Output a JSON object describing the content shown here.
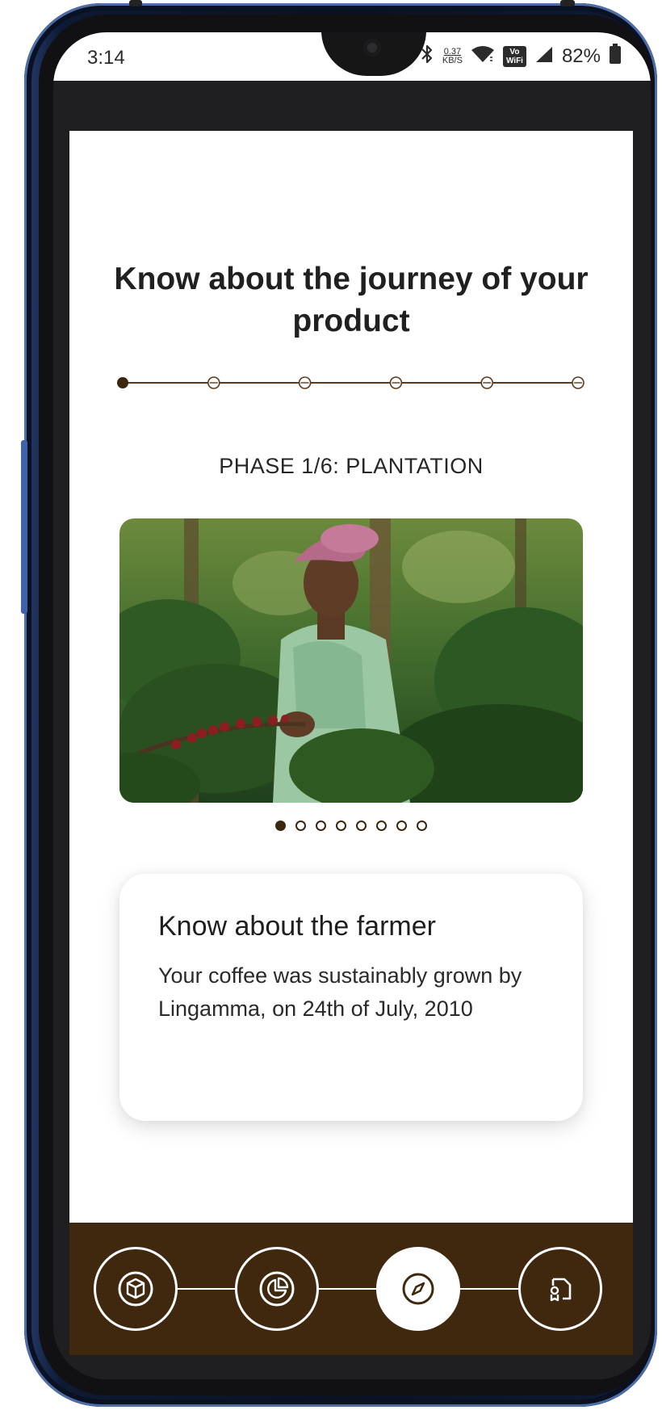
{
  "status_bar": {
    "time": "3:14",
    "network_speed_value": "0.37",
    "network_speed_unit": "KB/S",
    "volte_label_top": "Vo",
    "volte_label_bottom": "WiFi",
    "battery_percent": "82%",
    "icons": [
      "bluetooth-icon",
      "wifi-icon",
      "vowifi-icon",
      "signal-icon",
      "battery-icon"
    ]
  },
  "page": {
    "title": "Know about the journey of your product",
    "phase_label": "PHASE 1/6: PLANTATION",
    "timeline": {
      "total_steps": 6,
      "current_step": 1,
      "line_color": "#5a3a1a",
      "active_color": "#3b2610"
    },
    "carousel": {
      "total_slides": 8,
      "active_slide": 1
    },
    "card": {
      "title": "Know about the farmer",
      "body": "Your coffee was sustainably grown by Lingamma, on 24th of July, 2010"
    }
  },
  "bottom_nav": {
    "background": "#40280f",
    "items": [
      {
        "name": "package-icon",
        "active": false
      },
      {
        "name": "pie-chart-icon",
        "active": false
      },
      {
        "name": "compass-icon",
        "active": true
      },
      {
        "name": "certificate-icon",
        "active": false
      }
    ]
  }
}
